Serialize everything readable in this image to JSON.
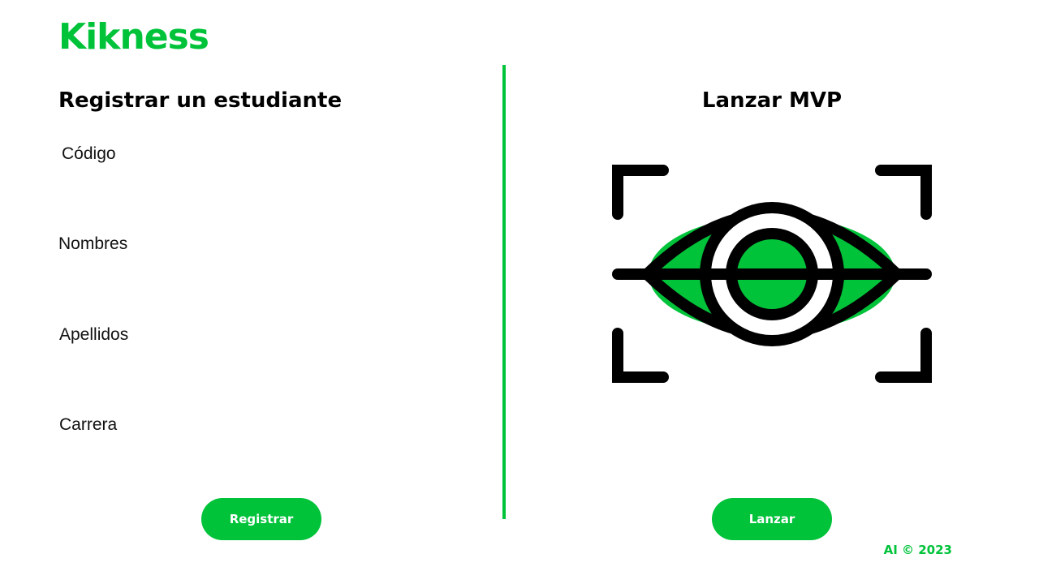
{
  "brand": {
    "name": "Kikness"
  },
  "colors": {
    "accent": "#00c33a",
    "text": "#000000",
    "background": "#ffffff"
  },
  "register": {
    "title": "Registrar un estudiante",
    "fields": [
      {
        "label": "Código",
        "value": ""
      },
      {
        "label": "Nombres",
        "value": ""
      },
      {
        "label": "Apellidos",
        "value": ""
      },
      {
        "label": "Carrera",
        "value": ""
      }
    ],
    "submit_label": "Registrar"
  },
  "launch": {
    "title": "Lanzar MVP",
    "icon": "eye-scan-icon",
    "button_label": "Lanzar"
  },
  "footer": {
    "text": "AI © 2023"
  }
}
